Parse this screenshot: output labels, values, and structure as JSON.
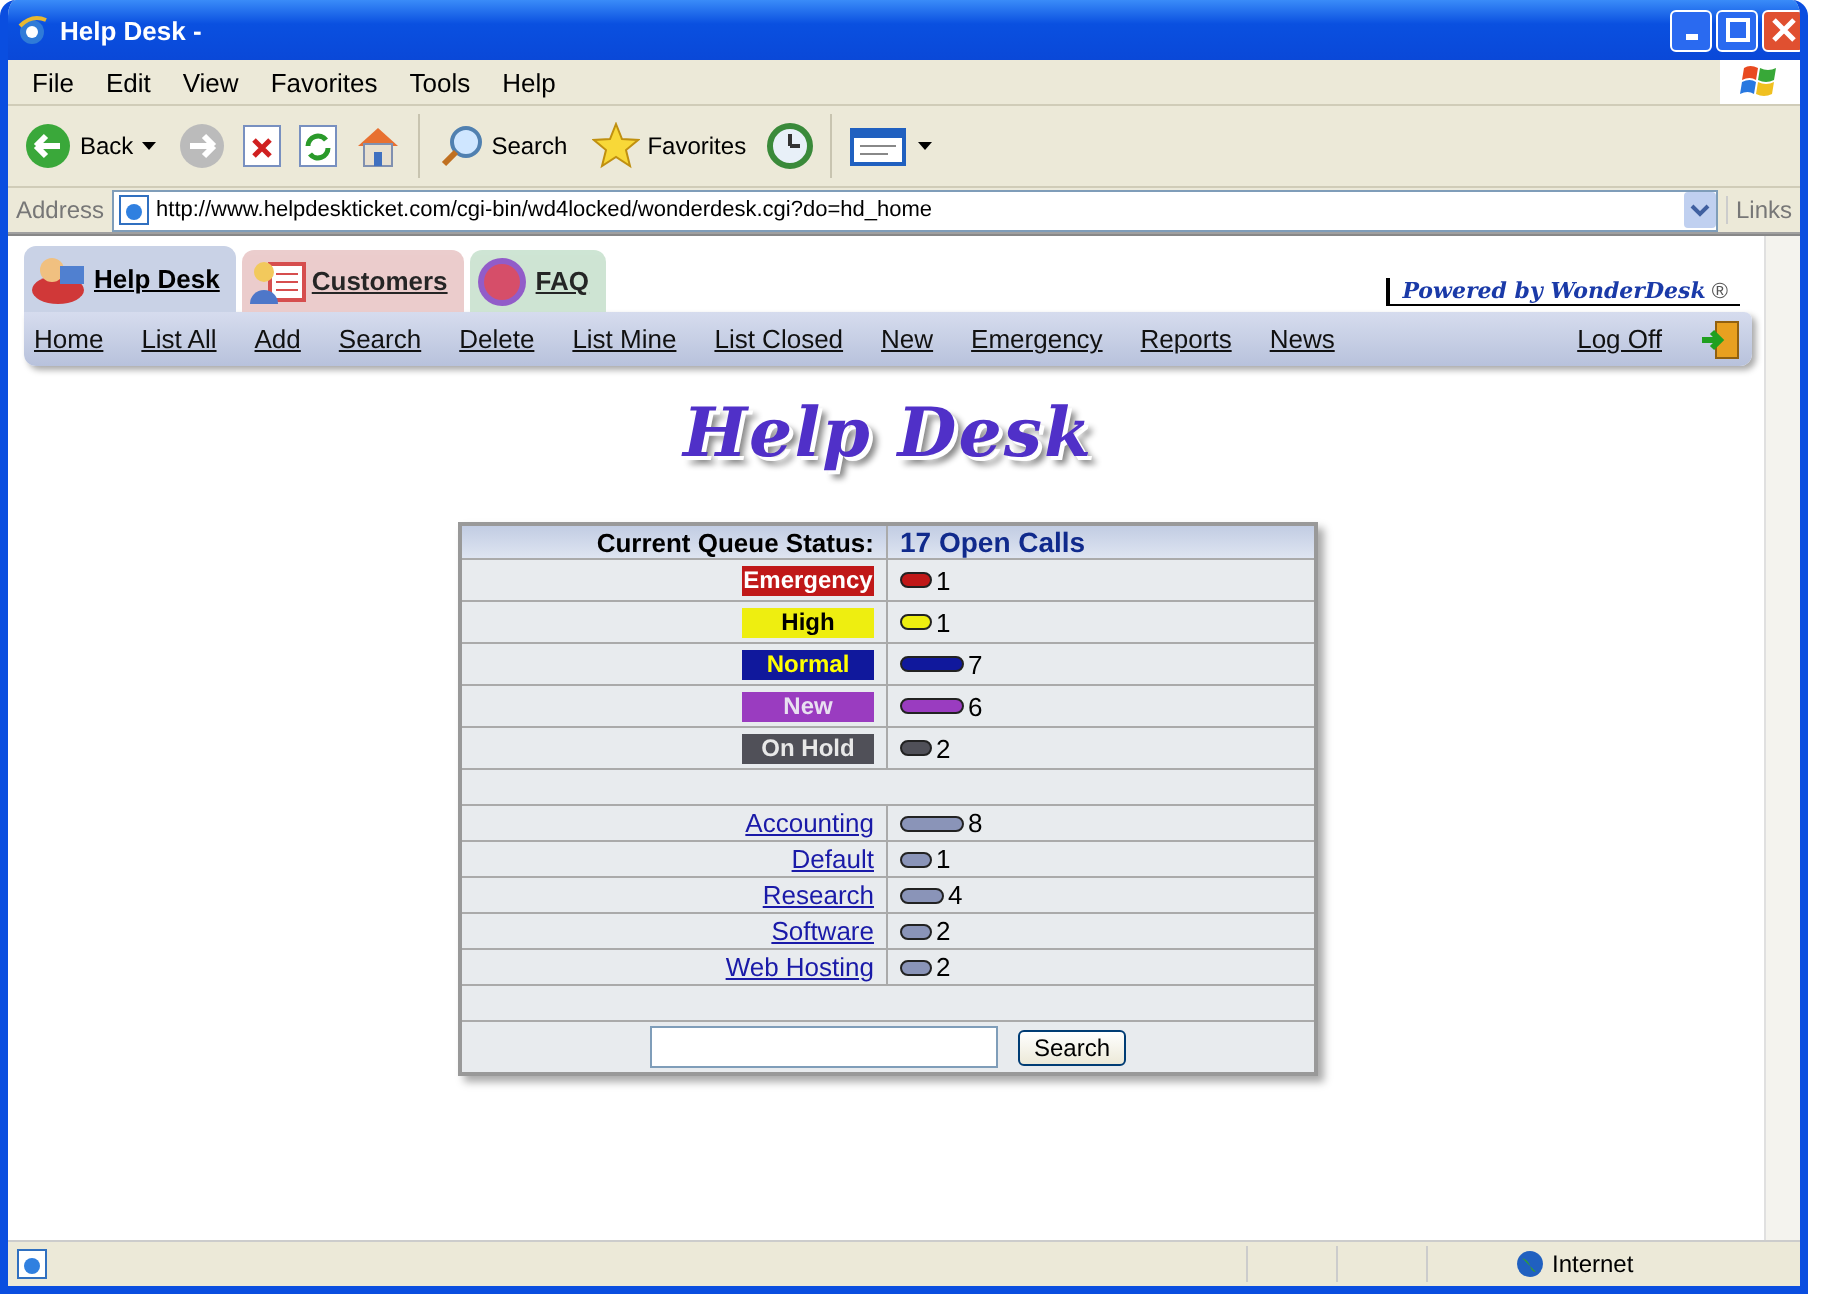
{
  "window": {
    "title": "Help Desk -"
  },
  "menu": [
    "File",
    "Edit",
    "View",
    "Favorites",
    "Tools",
    "Help"
  ],
  "toolbar": {
    "back": "Back",
    "search": "Search",
    "favorites": "Favorites"
  },
  "address": {
    "label": "Address",
    "url": "http://www.helpdeskticket.com/cgi-bin/wd4locked/wonderdesk.cgi?do=hd_home",
    "links": "Links"
  },
  "tabs": [
    {
      "label": "Help Desk",
      "selected": true,
      "color": "#c9d2e6"
    },
    {
      "label": "Customers",
      "selected": false,
      "color": "#e8c4c4"
    },
    {
      "label": "FAQ",
      "selected": false,
      "color": "#c6e0cc"
    }
  ],
  "powered_by": {
    "text": "Powered by WonderDesk",
    "mark": "®"
  },
  "nav": [
    "Home",
    "List All",
    "Add",
    "Search",
    "Delete",
    "List Mine",
    "List Closed",
    "New",
    "Emergency",
    "Reports",
    "News"
  ],
  "logoff": "Log Off",
  "logo_text": "Help Desk",
  "queue": {
    "label": "Current Queue Status:",
    "total": "17 Open Calls",
    "priorities": [
      {
        "label": "Emergency",
        "kind": "emergency",
        "color": "#c01818",
        "count": "1"
      },
      {
        "label": "High",
        "kind": "high",
        "color": "#eeee10",
        "count": "1"
      },
      {
        "label": "Normal",
        "kind": "normal",
        "color": "#10189c",
        "count": "7"
      },
      {
        "label": "New",
        "kind": "new",
        "color": "#9a3cc0",
        "count": "6"
      },
      {
        "label": "On Hold",
        "kind": "hold",
        "color": "#505058",
        "count": "2"
      }
    ],
    "departments": [
      {
        "label": "Accounting",
        "kind": "long",
        "count": "8"
      },
      {
        "label": "Default",
        "kind": "short",
        "count": "1"
      },
      {
        "label": "Research",
        "kind": "medium",
        "count": "4"
      },
      {
        "label": "Software",
        "kind": "short",
        "count": "2"
      },
      {
        "label": "Web Hosting",
        "kind": "short",
        "count": "2"
      }
    ],
    "search_button": "Search"
  },
  "status_bar": {
    "zone": "Internet"
  }
}
